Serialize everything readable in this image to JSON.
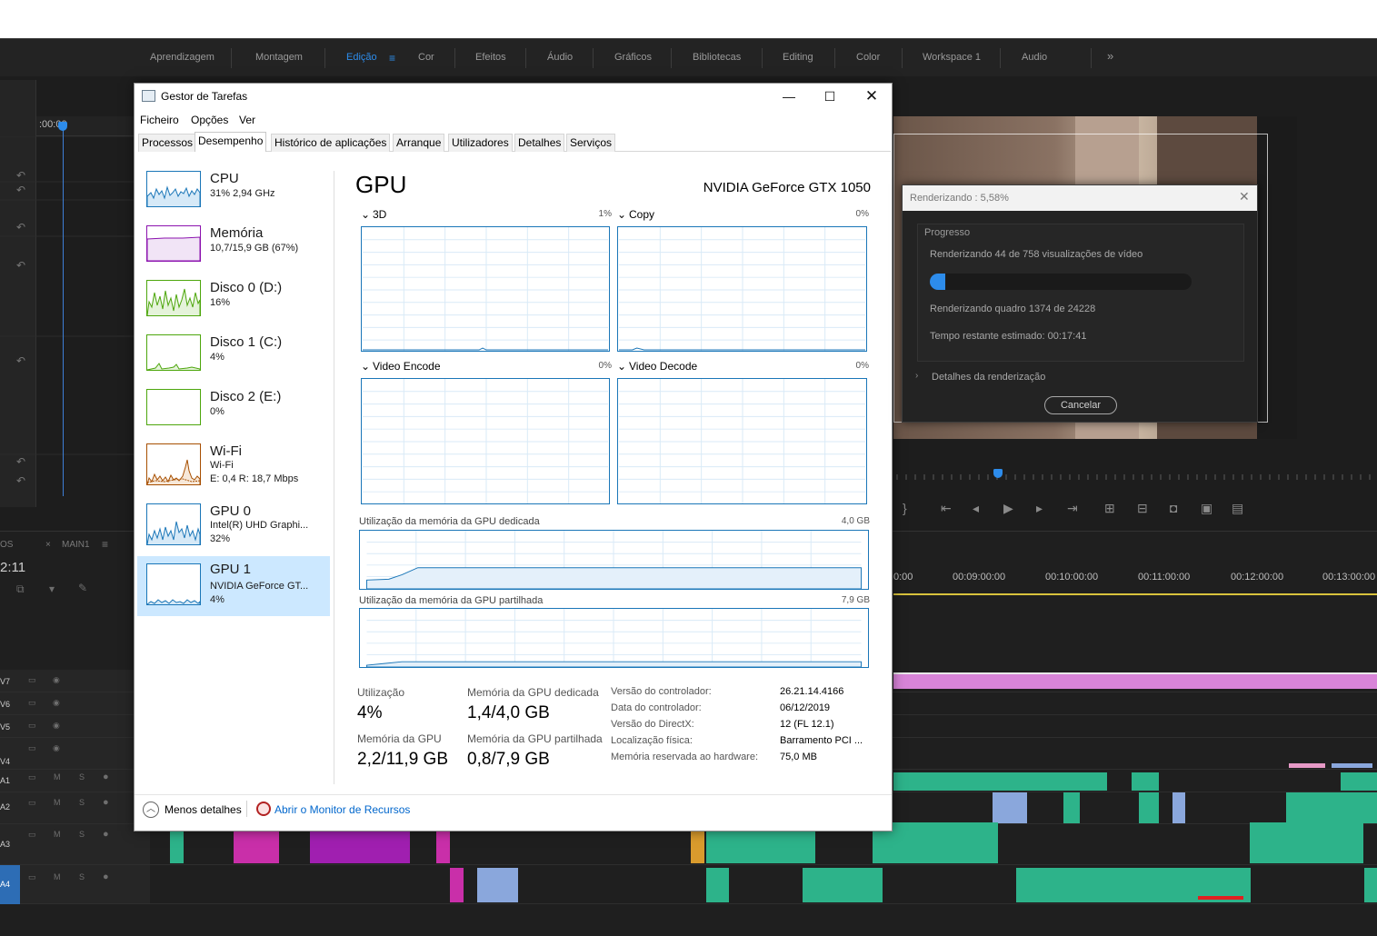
{
  "workspaces": {
    "tabs": [
      "Aprendizagem",
      "Montagem",
      "Edição",
      "Cor",
      "Efeitos",
      "Áudio",
      "Gráficos",
      "Bibliotecas",
      "Editing",
      "Color",
      "Workspace 1",
      "Audio"
    ],
    "active": "Edição",
    "menu_icon": "hamburger-icon",
    "overflow_icon": "double-chevron-icon"
  },
  "source": {
    "timecode": ":00:00"
  },
  "timeline": {
    "tab_prefix": "OS",
    "sequence_tab": "MAIN1",
    "timecode": "2:11",
    "ruler": [
      "0:00",
      "00:09:00:00",
      "00:10:00:00",
      "00:11:00:00",
      "00:12:00:00",
      "00:13:00:00"
    ],
    "tracks": [
      "V7",
      "V6",
      "V5",
      "V4",
      "A1",
      "A2",
      "A3",
      "A4"
    ],
    "audio_toggles": {
      "mute": "M",
      "solo": "S"
    }
  },
  "task_manager": {
    "title": "Gestor de Tarefas",
    "menu": [
      "Ficheiro",
      "Opções",
      "Ver"
    ],
    "tabs": [
      "Processos",
      "Desempenho",
      "Histórico de aplicações",
      "Arranque",
      "Utilizadores",
      "Detalhes",
      "Serviços"
    ],
    "active_tab": "Desempenho",
    "sidebar": [
      {
        "title": "CPU",
        "sub1": "31% 2,94 GHz",
        "sub2": "",
        "color": "#1a76b8"
      },
      {
        "title": "Memória",
        "sub1": "10,7/15,9 GB (67%)",
        "sub2": "",
        "color": "#8b12ae"
      },
      {
        "title": "Disco 0 (D:)",
        "sub1": "16%",
        "sub2": "",
        "color": "#4da60c"
      },
      {
        "title": "Disco 1 (C:)",
        "sub1": "4%",
        "sub2": "",
        "color": "#4da60c"
      },
      {
        "title": "Disco 2 (E:)",
        "sub1": "0%",
        "sub2": "",
        "color": "#4da60c"
      },
      {
        "title": "Wi-Fi",
        "sub1": "Wi-Fi",
        "sub2": "E: 0,4 R: 18,7 Mbps",
        "color": "#a74f01"
      },
      {
        "title": "GPU 0",
        "sub1": "Intel(R) UHD Graphi...",
        "sub2": "32%",
        "color": "#1a76b8"
      },
      {
        "title": "GPU 1",
        "sub1": "NVIDIA GeForce GT...",
        "sub2": "4%",
        "color": "#1a76b8"
      }
    ],
    "active_item": "GPU 1",
    "gpu": {
      "title": "GPU",
      "model": "NVIDIA GeForce GTX 1050",
      "engines": [
        {
          "name": "3D",
          "pct": "1%"
        },
        {
          "name": "Copy",
          "pct": "0%"
        },
        {
          "name": "Video Encode",
          "pct": "0%"
        },
        {
          "name": "Video Decode",
          "pct": "0%"
        }
      ],
      "dedicated_label": "Utilização da memória da GPU dedicada",
      "dedicated_max": "4,0 GB",
      "shared_label": "Utilização da memória da GPU partilhada",
      "shared_max": "7,9 GB",
      "stats": {
        "util_label": "Utilização",
        "util_value": "4%",
        "ded_label": "Memória da GPU dedicada",
        "ded_value": "1,4/4,0 GB",
        "gpumem_label": "Memória da GPU",
        "gpumem_value": "2,2/11,9 GB",
        "shared_label": "Memória da GPU partilhada",
        "shared_value": "0,8/7,9 GB"
      },
      "details": [
        {
          "k": "Versão do controlador:",
          "v": "26.21.14.4166"
        },
        {
          "k": "Data do controlador:",
          "v": "06/12/2019"
        },
        {
          "k": "Versão do DirectX:",
          "v": "12 (FL 12.1)"
        },
        {
          "k": "Localização física:",
          "v": "Barramento PCI ..."
        },
        {
          "k": "Memória reservada ao hardware:",
          "v": "75,0 MB"
        }
      ]
    },
    "fewer_details": "Menos detalhes",
    "resource_monitor": "Abrir o Monitor de Recursos"
  },
  "render_dialog": {
    "title": "Renderizando : 5,58%",
    "group": "Progresso",
    "line1": "Renderizando 44 de 758 visualizações de vídeo",
    "progress": 0.058,
    "line2": "Renderizando quadro 1374 de 24228",
    "line3": "Tempo restante estimado: 00:17:41",
    "details": "Detalhes da renderização",
    "cancel": "Cancelar"
  }
}
